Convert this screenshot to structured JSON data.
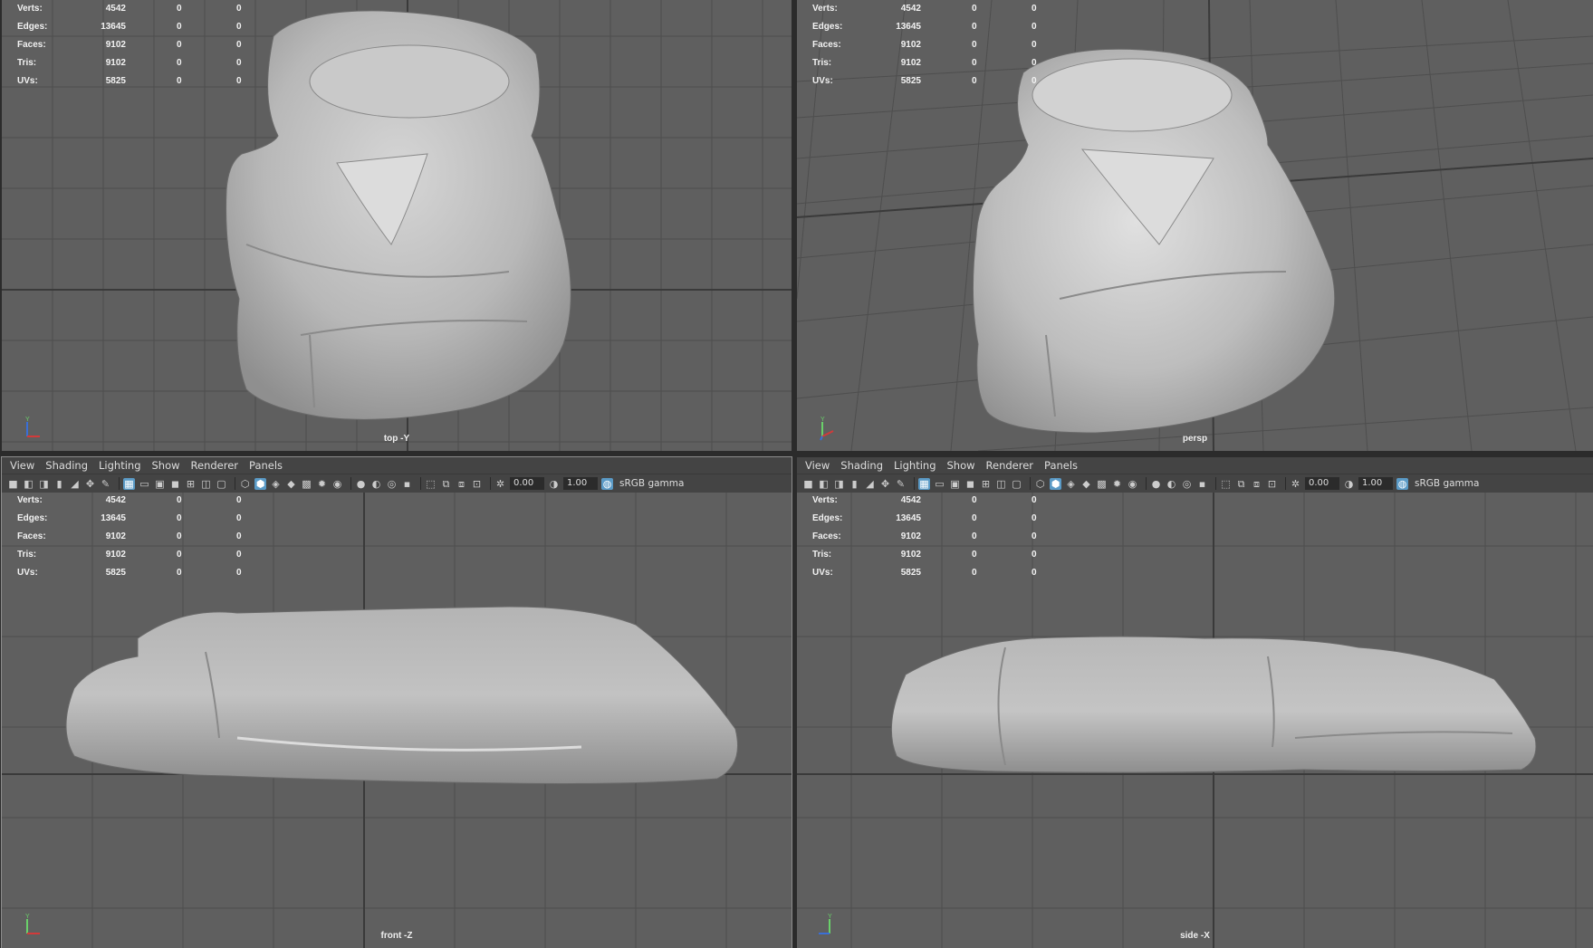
{
  "hud_labels": {
    "verts": "Verts:",
    "edges": "Edges:",
    "faces": "Faces:",
    "tris": "Tris:",
    "uvs": "UVs:"
  },
  "hud_values": {
    "verts": "4542",
    "edges": "13645",
    "faces": "9102",
    "tris": "9102",
    "uvs": "5825",
    "zero": "0"
  },
  "menu": {
    "view": "View",
    "shading": "Shading",
    "lighting": "Lighting",
    "show": "Show",
    "renderer": "Renderer",
    "panels": "Panels"
  },
  "toolbar": {
    "exposure": "0.00",
    "gamma_value": "1.00",
    "colorspace": "sRGB gamma"
  },
  "viewports": {
    "top": "top -Y",
    "persp": "persp",
    "front": "front -Z",
    "side": "side -X"
  },
  "axes": {
    "y": "Y",
    "z": "Z",
    "x": "X"
  },
  "colors": {
    "viewport_bg": "#5f5f5f",
    "grid": "#4e4e4e",
    "grid_axis": "#3a3a3a",
    "ui_bar": "#444444",
    "highlight": "#5a9ac6"
  }
}
